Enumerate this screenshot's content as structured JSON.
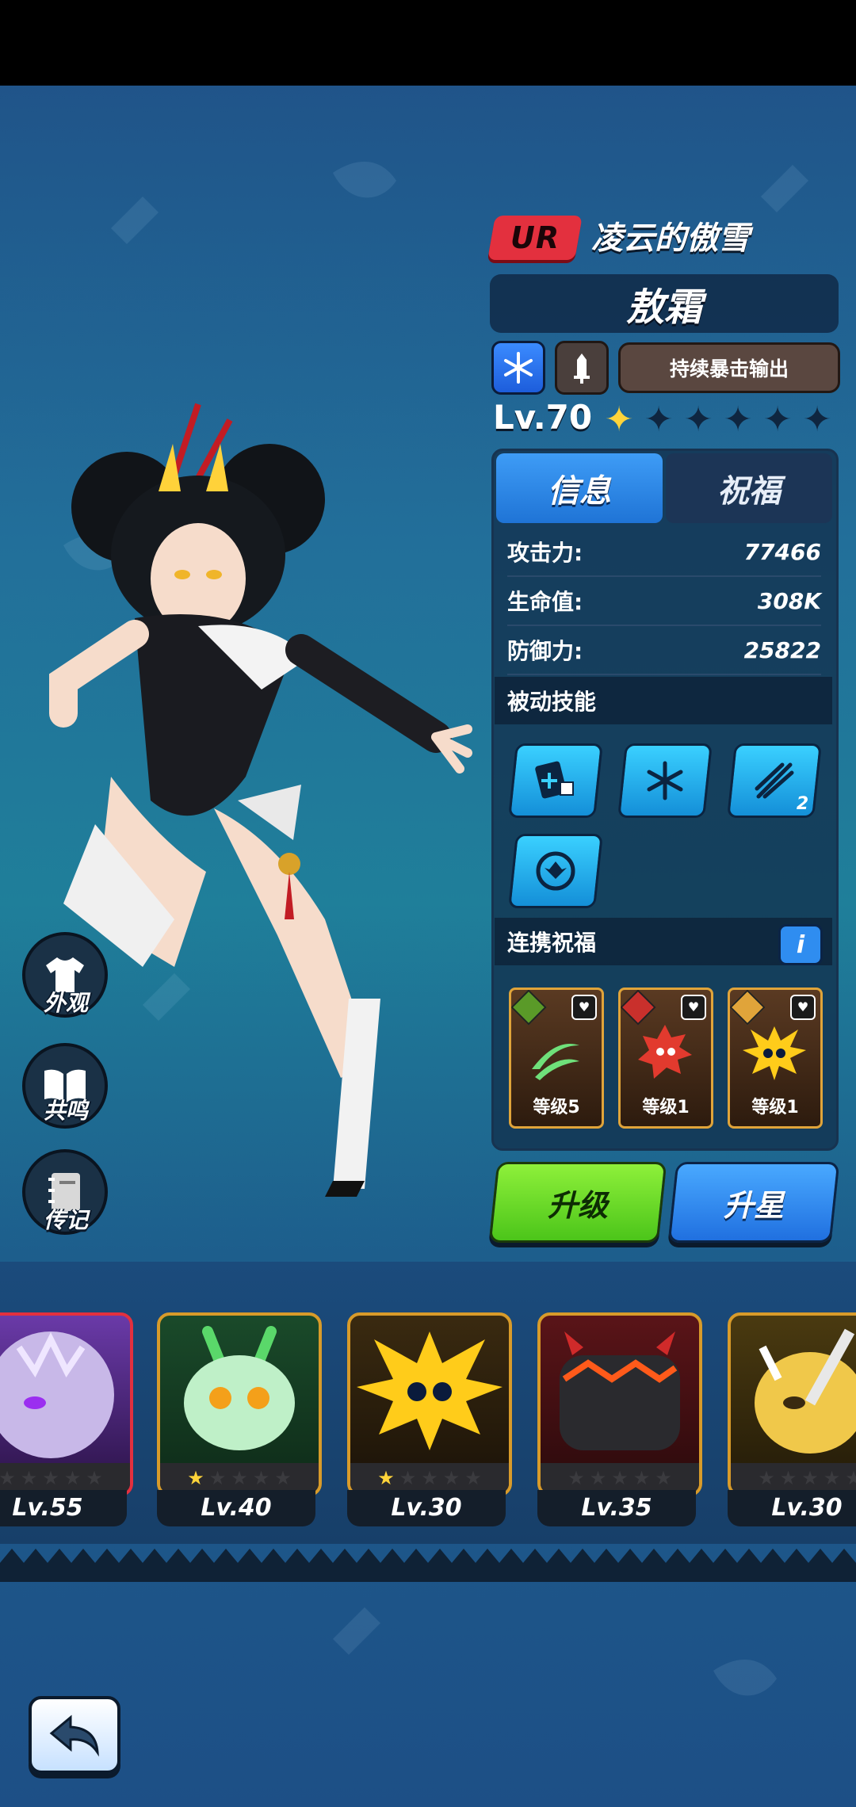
{
  "hero": {
    "rarity": "UR",
    "title": "凌云的傲雪",
    "name": "敖霜",
    "role": "持续暴击输出",
    "level": "Lv.70",
    "stars_filled": 1,
    "stars_total": 6
  },
  "tabs": {
    "info": "信息",
    "bless": "祝福"
  },
  "stats": [
    {
      "label": "攻击力:",
      "value": "77466"
    },
    {
      "label": "生命值:",
      "value": "308K"
    },
    {
      "label": "防御力:",
      "value": "25822"
    }
  ],
  "passive": {
    "title": "被动技能",
    "skill3_badge": "2"
  },
  "combo": {
    "title": "连携祝福",
    "info_label": "i",
    "cards": [
      {
        "level": "等级5"
      },
      {
        "level": "等级1"
      },
      {
        "level": "等级1"
      }
    ]
  },
  "buttons": {
    "upgrade": "升级",
    "star_up": "升星"
  },
  "side": {
    "appearance": "外观",
    "resonance": "共鸣",
    "biography": "传记"
  },
  "roster": [
    {
      "level": "Lv.55",
      "stars": 0
    },
    {
      "level": "Lv.40",
      "stars": 1
    },
    {
      "level": "Lv.30",
      "stars": 1
    },
    {
      "level": "Lv.35",
      "stars": 0
    },
    {
      "level": "Lv.30",
      "stars": 0
    }
  ],
  "colors": {
    "rarity": "#e3303e",
    "upgrade": "#6fdd2a",
    "star_up": "#2f8df0",
    "star_on": "#ffd43a"
  }
}
